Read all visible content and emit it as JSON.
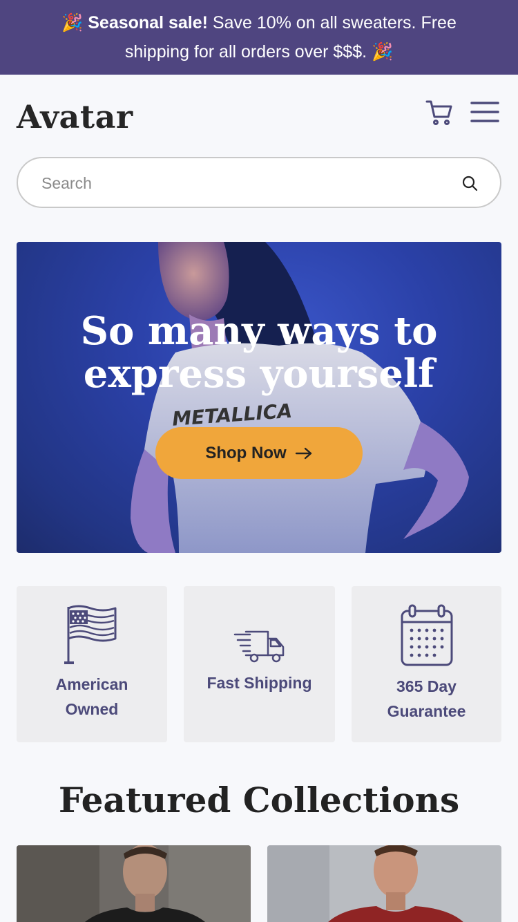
{
  "announcement": {
    "emoji": "🎉",
    "bold": "Seasonal sale!",
    "text_line1": " Save 10% on all sweaters. Free",
    "text_line2": "shipping for all orders over $$$."
  },
  "header": {
    "logo": "Avatar",
    "cart_icon": "cart-icon",
    "menu_icon": "hamburger-menu-icon"
  },
  "search": {
    "placeholder": "Search",
    "icon": "search-icon"
  },
  "hero": {
    "title_line1": "So many ways to",
    "title_line2": "express yourself",
    "shirt_text": "METALLICA",
    "cta_label": "Shop Now",
    "cta_icon": "arrow-right-icon"
  },
  "features": [
    {
      "line1": "American",
      "line2": "Owned",
      "icon": "flag-icon"
    },
    {
      "line1": "Fast Shipping",
      "line2": "",
      "icon": "delivery-truck-icon"
    },
    {
      "line1": "365 Day",
      "line2": "Guarantee",
      "icon": "calendar-icon"
    }
  ],
  "featured": {
    "title": "Featured Collections"
  },
  "colors": {
    "announcement_bg": "#4f4580",
    "accent": "#f0a63b",
    "feature_text": "#4c4a7a"
  }
}
